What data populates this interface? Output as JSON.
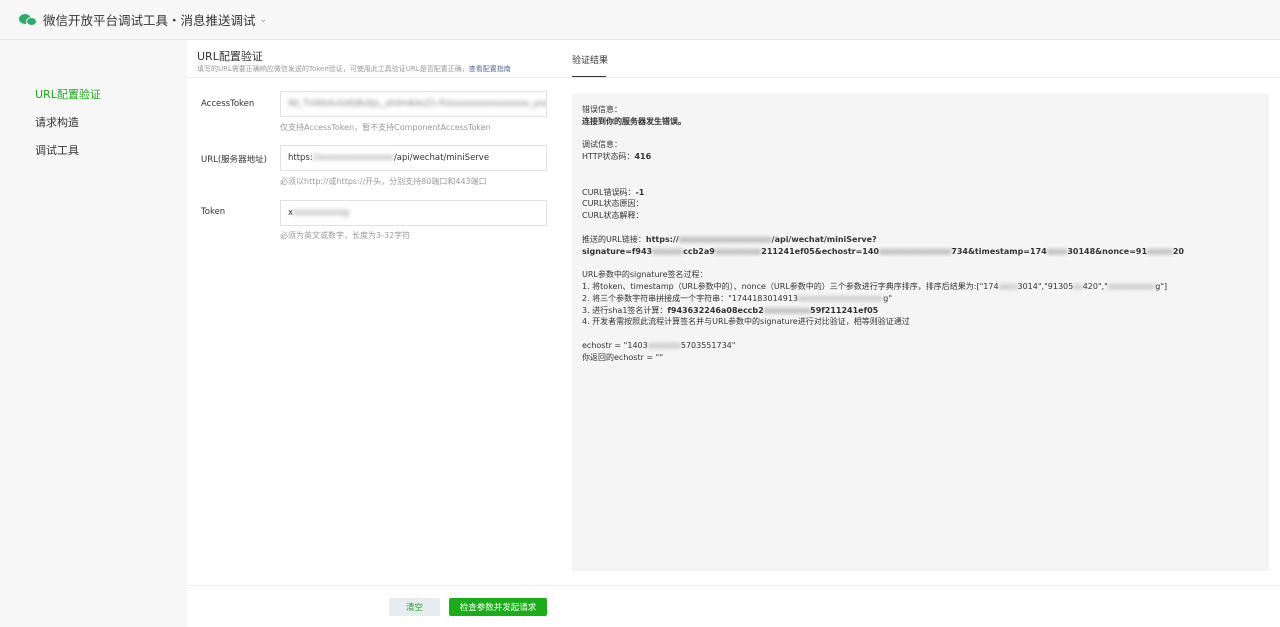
{
  "app": {
    "title": "微信开放平台调试工具・消息推送调试",
    "caret": "⌄"
  },
  "sidebar": {
    "items": [
      {
        "label": "URL配置验证",
        "active": true
      },
      {
        "label": "请求构造",
        "active": false
      },
      {
        "label": "调试工具",
        "active": false
      }
    ]
  },
  "form": {
    "title": "URL配置验证",
    "subtitle": "填写的URL需要正确响应微信发送的Token验证，可使用此工具验证URL是否配置正确，",
    "subtitle_link": "查看配置指南",
    "fields": [
      {
        "label": "AccessToken",
        "value_visible": "90_Tn0tb4vGdQ8ufpL_ah0mKAvZ1-fU",
        "value_blurred": "xxxxxxxxxxxxxxxx_ynanZf",
        "hint": "仅支持AccessToken，暂不支持ComponentAccessToken"
      },
      {
        "label": "URL(服务器地址)",
        "value_prefix": "https:",
        "value_blurred": "//xxxxxxxxxxxxxxx",
        "value_suffix": "/api/wechat/miniServe",
        "hint": "必须以http://或https://开头，分别支持80端口和443端口"
      },
      {
        "label": "Token",
        "value_visible": "x",
        "value_blurred": "xxxxxxxxxxg",
        "hint": "必须为英文或数字，长度为3-32字符"
      }
    ]
  },
  "result": {
    "tab": "验证结果",
    "lines": {
      "error_label": "错误信息：",
      "error_value": "连接到你的服务器发生错误。",
      "debug_label": "调试信息：",
      "http_status_label": "HTTP状态码：",
      "http_status_value": "416",
      "curl_code_label": "CURL错误码：",
      "curl_code_value": "-1",
      "curl_reason_label": "CURL状态原因：",
      "curl_desc_label": "CURL状态解释：",
      "url_label": "推送的URL链接：",
      "url_line1_a": "https://",
      "url_line1_blur": "xxxxxxxxxxxxxxxxxx",
      "url_line1_b": "/api/wechat/miniServe?",
      "url_line2_a": "signature=f943",
      "url_line2_blur1": "xxxxxx",
      "url_line2_b": "ccb2a9",
      "url_line2_blur2": "xxxxxxxxx",
      "url_line2_c": "211241ef05&echostr=140",
      "url_line2_blur3": "xxxxxxxxxxxxxx",
      "url_line2_d": "734&timestamp=174",
      "url_line2_blur4": "xxxx",
      "url_line2_e": "30148&nonce=91",
      "url_line2_blur5": "xxxxx",
      "url_line2_f": "20",
      "sig_title": "URL参数中的signature签名过程：",
      "step1_a": "1. 将token、timestamp（URL参数中的）、nonce（URL参数中的）三个参数进行字典序排序，排序后结果为:[\"174",
      "step1_blur1": "xxxx",
      "step1_b": "3014\",\"91305",
      "step1_blur2": "xx",
      "step1_c": "420\",\"",
      "step1_blur3": "xxxxxxxxxx",
      "step1_d": "g\"]",
      "step2_a": "2. 将三个参数字符串拼接成一个字符串：\"1744183014913",
      "step2_blur": "xxxxxxxxxxxxxxxxxx",
      "step2_b": "g\"",
      "step3_a": "3. 进行sha1签名计算：",
      "step3_b": "f943632246a08eccb2",
      "step3_blur": "xxxxxxxxx",
      "step3_c": "59f211241ef05",
      "step4": "4. 开发者需按照此流程计算签名并与URL参数中的signature进行对比验证，相等则验证通过",
      "echostr_a": "echostr = \"1403",
      "echostr_blur": "xxxxxxx",
      "echostr_b": "5703551734\"",
      "returned": "你返回的echostr = \"\""
    }
  },
  "footer": {
    "clear_label": "清空",
    "submit_label": "检查参数并发起请求"
  }
}
